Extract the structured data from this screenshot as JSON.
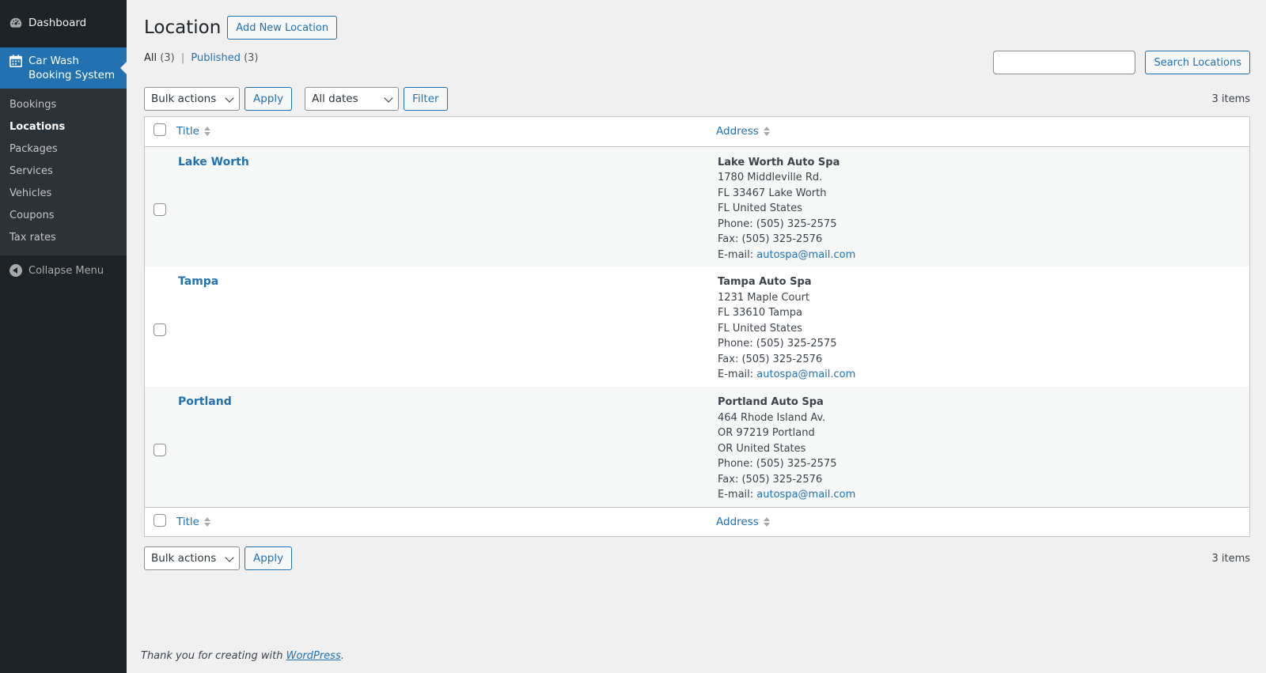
{
  "sidebar": {
    "dashboard_label": "Dashboard",
    "plugin_label_line1": "Car Wash",
    "plugin_label_line2": "Booking System",
    "submenu": [
      "Bookings",
      "Locations",
      "Packages",
      "Services",
      "Vehicles",
      "Coupons",
      "Tax rates"
    ],
    "active_item": "Locations",
    "collapse_label": "Collapse Menu"
  },
  "header": {
    "title": "Location",
    "add_new_label": "Add New Location"
  },
  "views": {
    "all_label": "All",
    "all_count": "(3)",
    "separator": "|",
    "published_label": "Published",
    "published_count": "(3)"
  },
  "search": {
    "placeholder": "",
    "button_label": "Search Locations"
  },
  "tablenav": {
    "bulk_actions": "Bulk actions",
    "apply": "Apply",
    "dates": "All dates",
    "filter": "Filter",
    "items_count": "3 items"
  },
  "table": {
    "columns": [
      "Title",
      "Address"
    ],
    "rows": [
      {
        "title": "Lake Worth",
        "address_name": "Lake Worth Auto Spa",
        "street": "1780 Middleville Rd.",
        "city_line": "FL 33467 Lake Worth",
        "country_line": "FL United States",
        "phone": "Phone: (505) 325-2575",
        "fax": "Fax: (505) 325-2576",
        "email_label": "E-mail:",
        "email": "autospa@mail.com"
      },
      {
        "title": "Tampa",
        "address_name": "Tampa Auto Spa",
        "street": "1231 Maple Court",
        "city_line": "FL 33610 Tampa",
        "country_line": "FL United States",
        "phone": "Phone: (505) 325-2575",
        "fax": "Fax: (505) 325-2576",
        "email_label": "E-mail:",
        "email": "autospa@mail.com"
      },
      {
        "title": "Portland",
        "address_name": "Portland Auto Spa",
        "street": "464 Rhode Island Av.",
        "city_line": "OR 97219 Portland",
        "country_line": "OR United States",
        "phone": "Phone: (505) 325-2575",
        "fax": "Fax: (505) 325-2576",
        "email_label": "E-mail:",
        "email": "autospa@mail.com"
      }
    ]
  },
  "footer": {
    "text": "Thank you for creating with",
    "link": "WordPress",
    "end": "."
  },
  "colors": {
    "sidebar_bg": "#1d2327",
    "submenu_bg": "#2c3338",
    "accent": "#2271b1",
    "page_bg": "#f0f0f1"
  },
  "icons": [
    "dashboard-gauge-icon",
    "calendar-icon",
    "collapse-arrow-icon",
    "sort-arrows-icon",
    "chevron-down-icon"
  ]
}
